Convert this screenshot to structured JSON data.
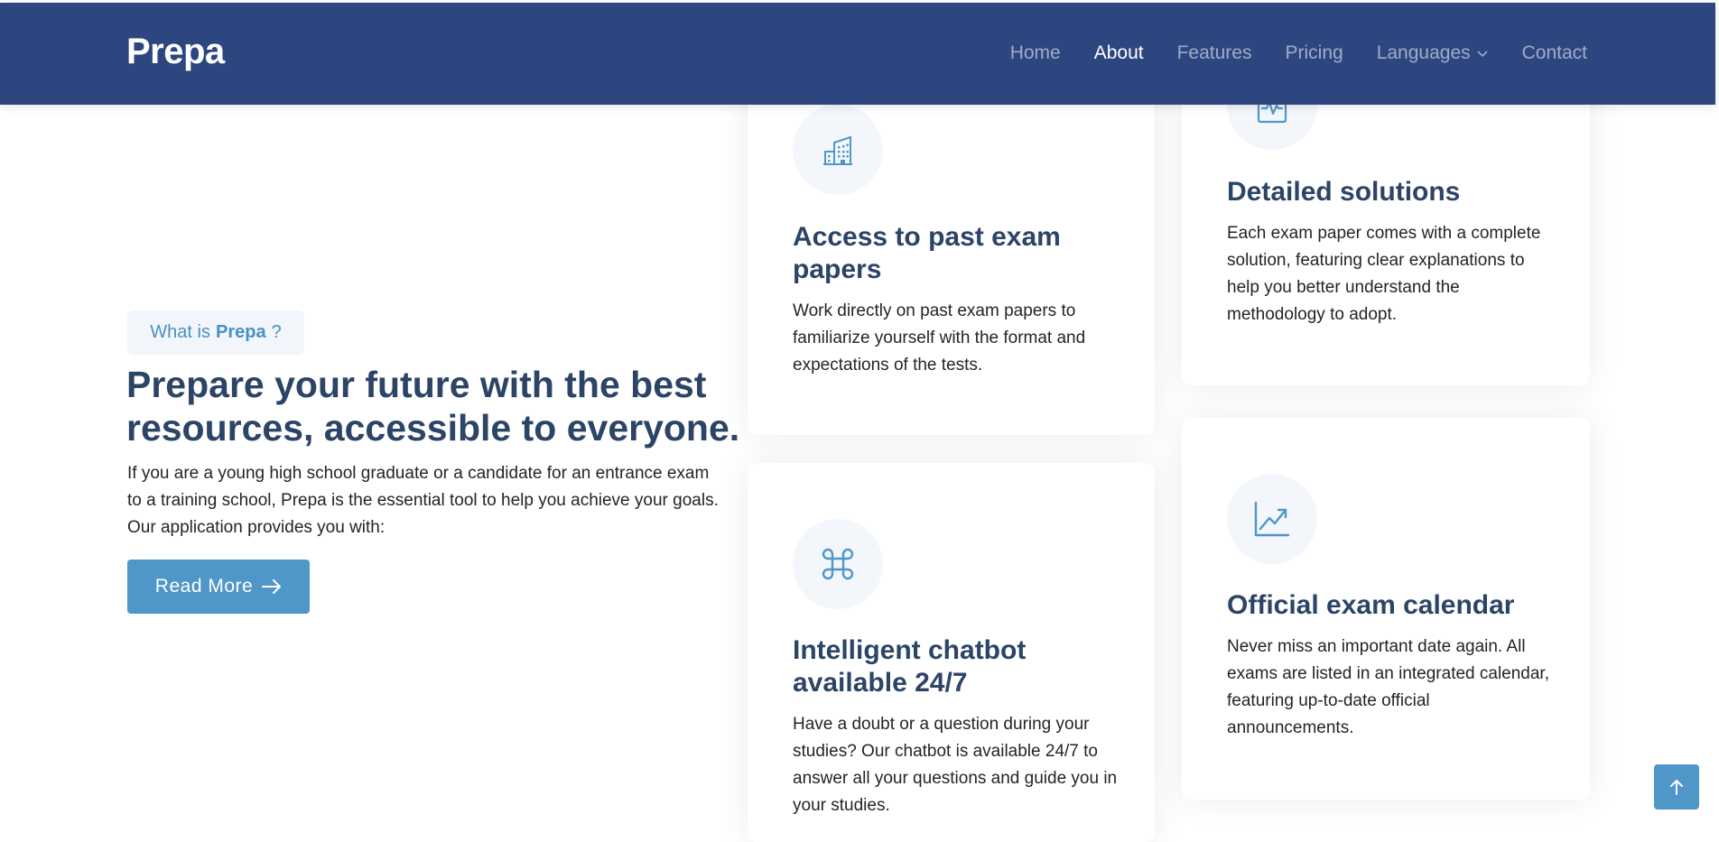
{
  "header": {
    "logo": "Prepa",
    "nav": {
      "home": "Home",
      "about": "About",
      "features": "Features",
      "pricing": "Pricing",
      "languages": "Languages",
      "contact": "Contact"
    }
  },
  "hero": {
    "badge_prefix": "What is",
    "badge_brand": "Prepa",
    "badge_suffix": "?",
    "title": "Prepare your future with the best resources, accessible to everyone.",
    "description": "If you are a young high school graduate or a candidate for an entrance exam to a training school, Prepa is the essential tool to help you achieve your goals. Our application provides you with:",
    "button_label": "Read More"
  },
  "cards": [
    {
      "icon": "building-icon",
      "title": "Access to past exam papers",
      "description": "Work directly on past exam papers to familiarize yourself with the format and expectations of the tests."
    },
    {
      "icon": "clipboard-pulse-icon",
      "title": "Detailed solutions",
      "description": "Each exam paper comes with a complete solution, featuring clear explanations to help you better understand the methodology to adopt."
    },
    {
      "icon": "command-icon",
      "title": "Intelligent chatbot available 24/7",
      "description": "Have a doubt or a question during your studies? Our chatbot is available 24/7 to answer all your questions and guide you in your studies."
    },
    {
      "icon": "graph-up-arrow-icon",
      "title": "Official exam calendar",
      "description": "Never miss an important date again. All exams are listed in an integrated calendar, featuring up-to-date official announcements."
    }
  ],
  "colors": {
    "header_bg": "#2d4680",
    "accent": "#4f96c9",
    "heading": "#2c4466",
    "icon_bg": "#f3f7fb"
  }
}
